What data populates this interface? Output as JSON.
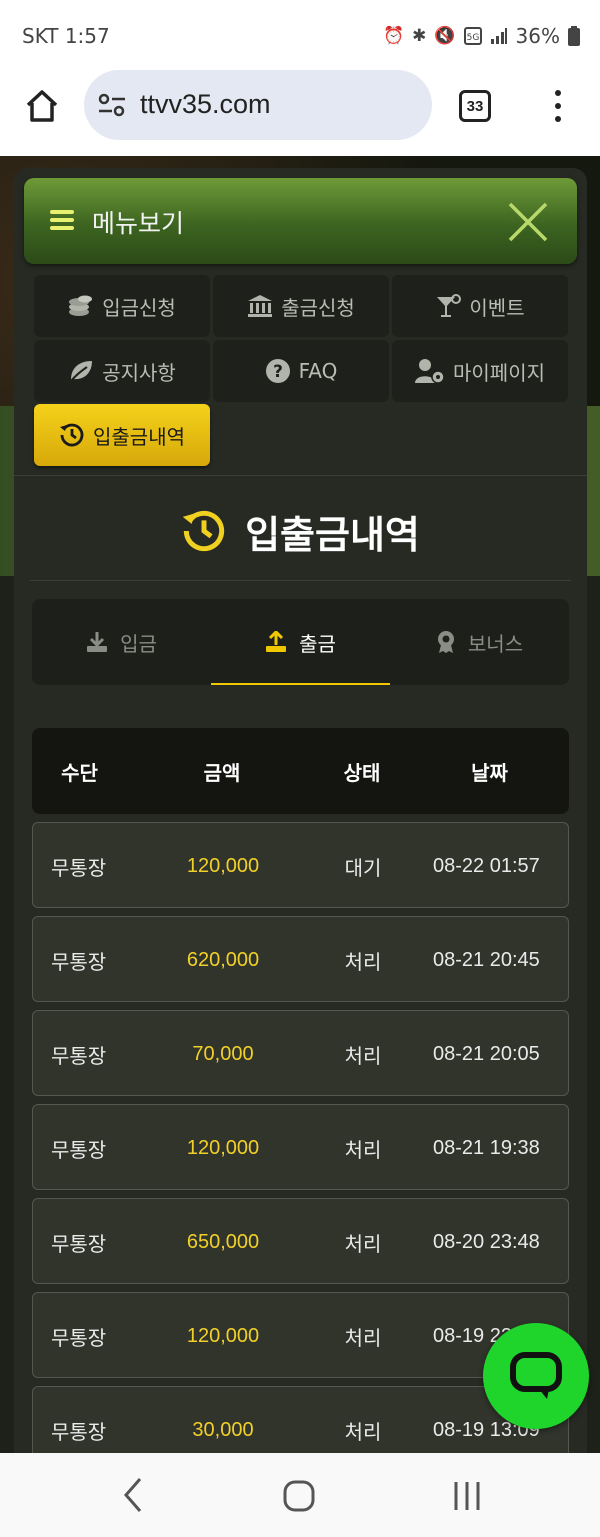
{
  "status_bar": {
    "carrier_time": "SKT 1:57",
    "battery": "36%",
    "icons": [
      "alarm-icon",
      "bluetooth-icon",
      "mute-icon",
      "5g-icon",
      "signal-icon",
      "battery-icon"
    ]
  },
  "browser": {
    "url": "ttvv35.com",
    "tab_count": "33"
  },
  "menu": {
    "title": "메뉴보기",
    "items": [
      {
        "label": "입금신청",
        "icon": "coins-icon"
      },
      {
        "label": "출금신청",
        "icon": "bank-icon"
      },
      {
        "label": "이벤트",
        "icon": "cocktail-icon"
      },
      {
        "label": "공지사항",
        "icon": "leaf-icon"
      },
      {
        "label": "FAQ",
        "icon": "question-icon"
      },
      {
        "label": "마이페이지",
        "icon": "user-gear-icon"
      },
      {
        "label": "입출금내역",
        "icon": "history-icon",
        "active": true
      }
    ]
  },
  "page": {
    "title": "입출금내역"
  },
  "tabs": [
    {
      "label": "입금",
      "icon": "download-icon"
    },
    {
      "label": "출금",
      "icon": "upload-icon",
      "active": true
    },
    {
      "label": "보너스",
      "icon": "award-icon"
    }
  ],
  "table": {
    "headers": [
      "수단",
      "금액",
      "상태",
      "날짜"
    ],
    "rows": [
      {
        "method": "무통장",
        "amount": "120,000",
        "status": "대기",
        "date": "08-22 01:57"
      },
      {
        "method": "무통장",
        "amount": "620,000",
        "status": "처리",
        "date": "08-21 20:45"
      },
      {
        "method": "무통장",
        "amount": "70,000",
        "status": "처리",
        "date": "08-21 20:05"
      },
      {
        "method": "무통장",
        "amount": "120,000",
        "status": "처리",
        "date": "08-21 19:38"
      },
      {
        "method": "무통장",
        "amount": "650,000",
        "status": "처리",
        "date": "08-20 23:48"
      },
      {
        "method": "무통장",
        "amount": "120,000",
        "status": "처리",
        "date": "08-19 22"
      },
      {
        "method": "무통장",
        "amount": "30,000",
        "status": "처리",
        "date": "08-19 13:09"
      }
    ]
  },
  "colors": {
    "accent_yellow": "#f2d02a",
    "header_green": "#3c6420",
    "chat_green": "#1fd52b"
  }
}
